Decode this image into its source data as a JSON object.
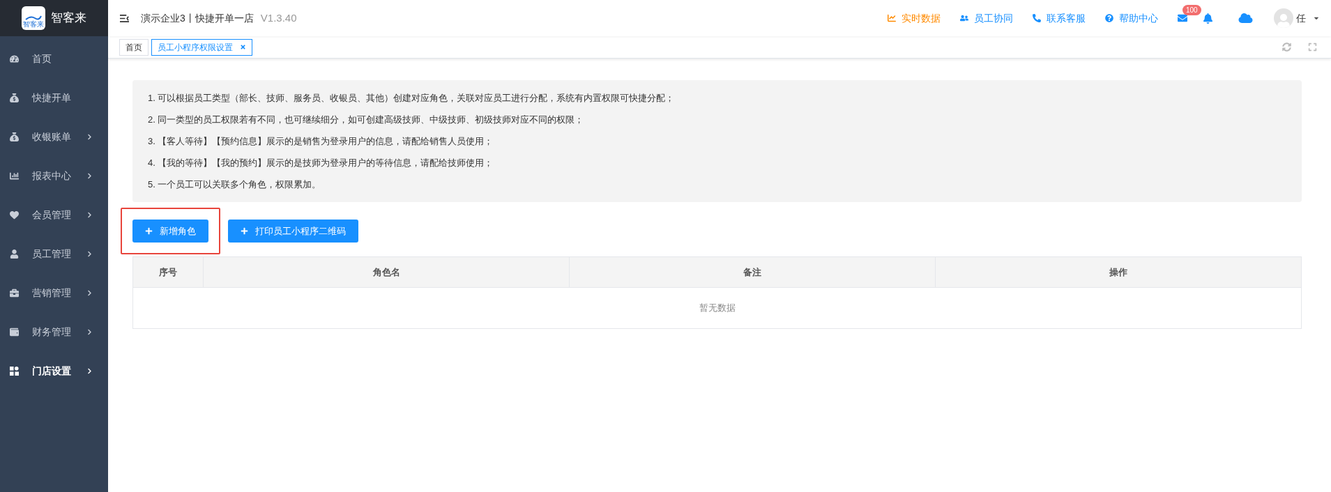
{
  "brand": {
    "logo_text": "智客来",
    "name": "智客来"
  },
  "sidebar": {
    "items": [
      {
        "label": "首页",
        "selected": false,
        "expandable": false
      },
      {
        "label": "快捷开单",
        "selected": false,
        "expandable": false
      },
      {
        "label": "收银账单",
        "selected": false,
        "expandable": true
      },
      {
        "label": "报表中心",
        "selected": false,
        "expandable": true
      },
      {
        "label": "会员管理",
        "selected": false,
        "expandable": true
      },
      {
        "label": "员工管理",
        "selected": false,
        "expandable": true
      },
      {
        "label": "营销管理",
        "selected": false,
        "expandable": true
      },
      {
        "label": "财务管理",
        "selected": false,
        "expandable": true
      },
      {
        "label": "门店设置",
        "selected": true,
        "expandable": true
      }
    ]
  },
  "header": {
    "store": "演示企业3丨快捷开单一店",
    "version": "V1.3.40",
    "links": [
      {
        "label": "实时数据",
        "color": "#ff8a00"
      },
      {
        "label": "员工协同",
        "color": "#1890ff"
      },
      {
        "label": "联系客服",
        "color": "#1890ff"
      },
      {
        "label": "帮助中心",
        "color": "#1890ff"
      }
    ],
    "mail_badge": "100",
    "user": "任"
  },
  "tabs": [
    {
      "label": "首页",
      "selected": false,
      "closable": false
    },
    {
      "label": "员工小程序权限设置",
      "selected": true,
      "closable": true
    }
  ],
  "notes": [
    "1. 可以根据员工类型（部长、技师、服务员、收银员、其他）创建对应角色，关联对应员工进行分配，系统有内置权限可快捷分配；",
    "2. 同一类型的员工权限若有不同，也可继续细分，如可创建高级技师、中级技师、初级技师对应不同的权限；",
    "3. 【客人等待】【预约信息】展示的是销售为登录用户的信息，请配给销售人员使用；",
    "4. 【我的等待】【我的预约】展示的是技师为登录用户的等待信息，请配给技师使用；",
    "5. 一个员工可以关联多个角色，权限累加。"
  ],
  "buttons": [
    {
      "label": "新增角色",
      "highlighted": true
    },
    {
      "label": "打印员工小程序二维码",
      "highlighted": false
    }
  ],
  "table": {
    "columns": [
      "序号",
      "角色名",
      "备注",
      "操作"
    ],
    "empty_text": "暂无数据"
  }
}
